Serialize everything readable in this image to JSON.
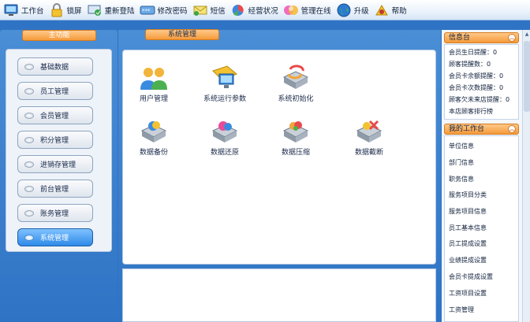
{
  "toolbar": {
    "items": [
      {
        "label": "工作台",
        "icon": "desktop-icon"
      },
      {
        "label": "锁屏",
        "icon": "lock-icon"
      },
      {
        "label": "重新登陆",
        "icon": "relogin-icon"
      },
      {
        "label": "修改密码",
        "icon": "password-icon"
      },
      {
        "label": "短信",
        "icon": "sms-icon"
      },
      {
        "label": "经营状况",
        "icon": "chart-icon"
      },
      {
        "label": "管理在线",
        "icon": "online-icon"
      },
      {
        "label": "升级",
        "icon": "globe-icon"
      },
      {
        "label": "帮助",
        "icon": "help-icon"
      }
    ]
  },
  "left": {
    "title": "主功能",
    "nav": [
      {
        "label": "基础数据"
      },
      {
        "label": "员工管理"
      },
      {
        "label": "会员管理"
      },
      {
        "label": "积分管理"
      },
      {
        "label": "进销存管理"
      },
      {
        "label": "前台管理"
      },
      {
        "label": "账务管理"
      },
      {
        "label": "系统管理",
        "active": true
      }
    ]
  },
  "main": {
    "title": "系统管理",
    "functions": [
      {
        "label": "用户管理",
        "icon": "users-icon"
      },
      {
        "label": "系统运行参数",
        "icon": "system-params-icon"
      },
      {
        "label": "系统初始化",
        "icon": "system-init-icon"
      },
      {
        "label": "数据备份",
        "icon": "data-backup-icon"
      },
      {
        "label": "数据还原",
        "icon": "data-restore-icon"
      },
      {
        "label": "数据压缩",
        "icon": "data-compress-icon"
      },
      {
        "label": "数据截断",
        "icon": "data-truncate-icon"
      }
    ]
  },
  "info": {
    "title": "信息台",
    "lines": [
      "会员生日提醒：0",
      "顾客提醒数：0",
      "会员卡余额提醒：0",
      "会员卡次数提醒：0",
      "顾客欠未来店提醒：0",
      "本店顾客排行榜"
    ]
  },
  "workbench": {
    "title": "我的工作台",
    "items": [
      "单位信息",
      "部门信息",
      "职务信息",
      "服务项目分类",
      "服务项目信息",
      "员工基本信息",
      "员工提成设置",
      "业绩提成设置",
      "会员卡提成设置",
      "工资项目设置",
      "工资管理"
    ]
  },
  "colors": {
    "accent_orange": "#f59a3a",
    "panel_blue": "#2f73c5",
    "active_nav_blue": "#2f8ae8"
  }
}
